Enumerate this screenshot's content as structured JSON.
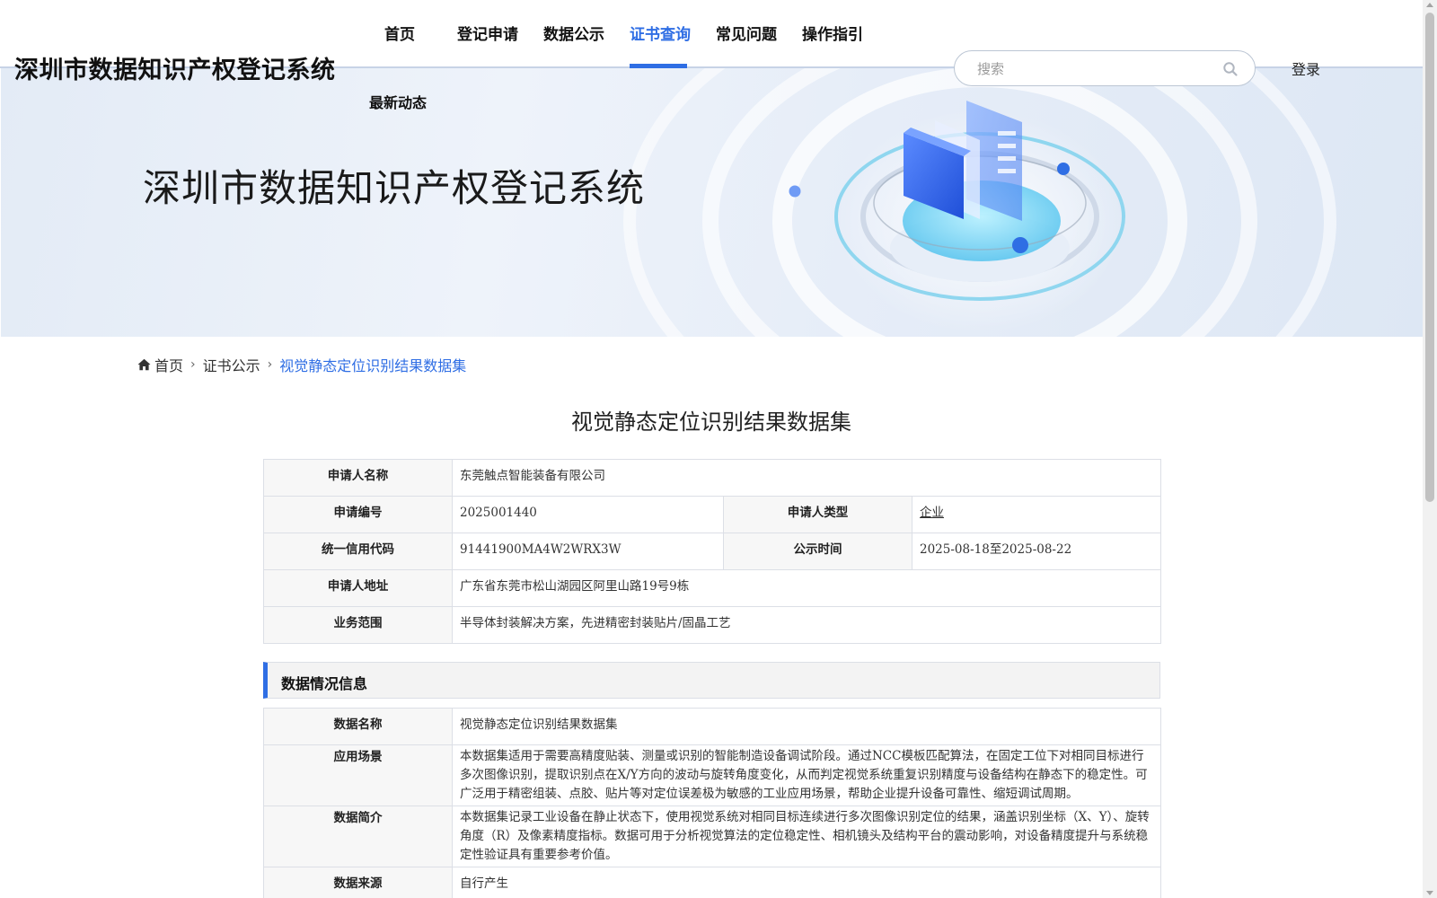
{
  "header": {
    "site_title": "深圳市数据知识产权登记系统",
    "nav": [
      {
        "label": "首页",
        "active": false
      },
      {
        "label": "登记申请",
        "active": false
      },
      {
        "label": "数据公示",
        "active": false
      },
      {
        "label": "证书查询",
        "active": true
      },
      {
        "label": "常见问题",
        "active": false
      },
      {
        "label": "操作指引",
        "active": false
      },
      {
        "label": "最新动态",
        "active": false
      }
    ],
    "search": {
      "placeholder": "搜索",
      "value": ""
    },
    "login_label": "登录",
    "accent_color": "#2f6ee4"
  },
  "banner": {
    "title": "深圳市数据知识产权登记系统"
  },
  "breadcrumb": {
    "home": "首页",
    "level1": "证书公示",
    "current": "视觉静态定位识别结果数据集"
  },
  "page_title": "视觉静态定位识别结果数据集",
  "applicant": {
    "name_label": "申请人名称",
    "name_value": "东莞触点智能装备有限公司",
    "app_no_label": "申请编号",
    "app_no_value": "2025001440",
    "type_label": "申请人类型",
    "type_value": "企业",
    "credit_label": "统一信用代码",
    "credit_value": "91441900MA4W2WRX3W",
    "publish_label": "公示时间",
    "publish_value": "2025-08-18至2025-08-22",
    "address_label": "申请人地址",
    "address_value": "广东省东莞市松山湖园区阿里山路19号9栋",
    "scope_label": "业务范围",
    "scope_value": "半导体封装解决方案，先进精密封装贴片/固晶工艺"
  },
  "data_section": {
    "heading": "数据情况信息",
    "rows": [
      {
        "label": "数据名称",
        "value": "视觉静态定位识别结果数据集"
      },
      {
        "label": "应用场景",
        "value": "本数据集适用于需要高精度贴装、测量或识别的智能制造设备调试阶段。通过NCC模板匹配算法，在固定工位下对相同目标进行多次图像识别，提取识别点在X/Y方向的波动与旋转角度变化，从而判定视觉系统重复识别精度与设备结构在静态下的稳定性。可广泛用于精密组装、点胶、贴片等对定位误差极为敏感的工业应用场景，帮助企业提升设备可靠性、缩短调试周期。"
      },
      {
        "label": "数据简介",
        "value": "本数据集记录工业设备在静止状态下，使用视觉系统对相同目标连续进行多次图像识别定位的结果，涵盖识别坐标（X、Y）、旋转角度（R）及像素精度指标。数据可用于分析视觉算法的定位稳定性、相机镜头及结构平台的震动影响，对设备精度提升与系统稳定性验证具有重要参考价值。"
      },
      {
        "label": "数据来源",
        "value": "自行产生"
      }
    ]
  }
}
